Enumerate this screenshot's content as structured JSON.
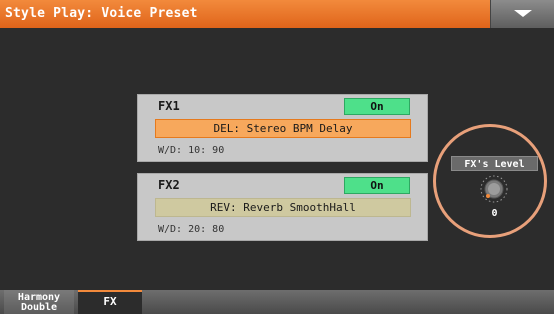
{
  "header": {
    "title": "Style Play: Voice Preset",
    "menu_icon": "chevron-down-icon"
  },
  "fx1": {
    "title": "FX1",
    "state": "On",
    "type": "DEL: Stereo BPM Delay",
    "wd": "W/D:  10: 90"
  },
  "fx2": {
    "title": "FX2",
    "state": "On",
    "type": "REV: Reverb SmoothHall",
    "wd": "W/D:  20: 80"
  },
  "fx_level": {
    "label": "FX's Level",
    "value": "0"
  },
  "tabs": [
    {
      "label_line1": "Harmony",
      "label_line2": "Double"
    },
    {
      "label": "FX"
    }
  ],
  "colors": {
    "title_bar": "#e87228",
    "on_button": "#4ee08a",
    "fx1_type_bg": "#f7a85c",
    "fx2_type_bg": "#cfc9a0",
    "highlight_circle": "#e8a07a"
  }
}
